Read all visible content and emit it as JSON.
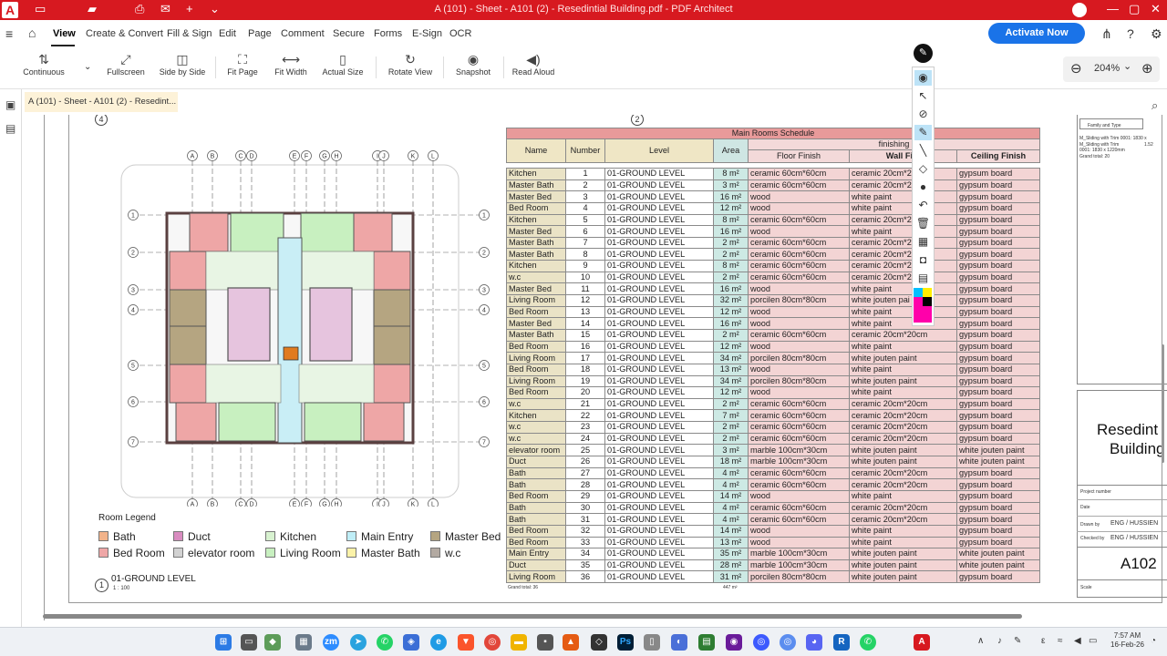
{
  "app": {
    "window_title": "A (101) - Sheet - A101 (2) - Resedintial Building.pdf  -  PDF Architect",
    "logo": "A"
  },
  "menu": {
    "items": [
      "View",
      "Create & Convert",
      "Fill & Sign",
      "Edit",
      "Page",
      "Comment",
      "Secure",
      "Forms",
      "E-Sign",
      "OCR"
    ],
    "active": "View",
    "activate_label": "Activate Now"
  },
  "toolbar": {
    "continuous": "Continuous",
    "fullscreen": "Fullscreen",
    "side_by_side": "Side by Side",
    "fit_page": "Fit Page",
    "fit_width": "Fit Width",
    "actual_size": "Actual Size",
    "rotate_view": "Rotate View",
    "snapshot": "Snapshot",
    "read_aloud": "Read Aloud",
    "zoom": "204%"
  },
  "tab": {
    "label": "A (101) - Sheet - A101 (2) - Resedint..."
  },
  "drawing": {
    "view_number_left": "4",
    "view_number_right": "2",
    "grid_columns": [
      "A",
      "B",
      "C",
      "D",
      "E",
      "F",
      "G",
      "H",
      "I",
      "J",
      "K",
      "L"
    ],
    "grid_rows": [
      "1",
      "2",
      "3",
      "4",
      "5",
      "6",
      "7"
    ],
    "legend_title": "Room Legend",
    "legend": [
      {
        "label": "Bath",
        "color": "#f2b38a"
      },
      {
        "label": "Duct",
        "color": "#d98cc0"
      },
      {
        "label": "Kitchen",
        "color": "#d8f2d0"
      },
      {
        "label": "Main Entry",
        "color": "#bfeef7"
      },
      {
        "label": "Master Bed",
        "color": "#b5a581"
      },
      {
        "label": "Bed Room",
        "color": "#eea6a6"
      },
      {
        "label": "elevator room",
        "color": "#d2d2d2"
      },
      {
        "label": "Living Room",
        "color": "#c8f0c0"
      },
      {
        "label": "Master Bath",
        "color": "#fbf2a8"
      },
      {
        "label": "w.c",
        "color": "#b3aaa2"
      }
    ],
    "level_number": "1",
    "level_name": "01-GROUND LEVEL",
    "level_scale": "1 : 100"
  },
  "schedule": {
    "title": "Main Rooms Schedule",
    "headers": {
      "name": "Name",
      "number": "Number",
      "level": "Level",
      "area": "Area",
      "finishing": "finishing",
      "floor": "Floor Finish",
      "wall": "Wall Fini",
      "ceiling": "Ceiling Finish"
    },
    "rows": [
      [
        "Kitchen",
        "1",
        "01-GROUND LEVEL",
        "8 m²",
        "ceramic 60cm*60cm",
        "ceramic 20cm*2",
        "gypsum board"
      ],
      [
        "Master Bath",
        "2",
        "01-GROUND LEVEL",
        "3 m²",
        "ceramic 60cm*60cm",
        "ceramic 20cm*2",
        "gypsum board"
      ],
      [
        "Master Bed",
        "3",
        "01-GROUND LEVEL",
        "16 m²",
        "wood",
        "white paint",
        "gypsum board"
      ],
      [
        "Bed Room",
        "4",
        "01-GROUND LEVEL",
        "12 m²",
        "wood",
        "white paint",
        "gypsum board"
      ],
      [
        "Kitchen",
        "5",
        "01-GROUND LEVEL",
        "8 m²",
        "ceramic 60cm*60cm",
        "ceramic 20cm*2",
        "gypsum board"
      ],
      [
        "Master Bed",
        "6",
        "01-GROUND LEVEL",
        "16 m²",
        "wood",
        "white paint",
        "gypsum board"
      ],
      [
        "Master Bath",
        "7",
        "01-GROUND LEVEL",
        "2 m²",
        "ceramic 60cm*60cm",
        "ceramic 20cm*2",
        "gypsum board"
      ],
      [
        "Master Bath",
        "8",
        "01-GROUND LEVEL",
        "2 m²",
        "ceramic 60cm*60cm",
        "ceramic 20cm*2",
        "gypsum board"
      ],
      [
        "Kitchen",
        "9",
        "01-GROUND LEVEL",
        "8 m²",
        "ceramic 60cm*60cm",
        "ceramic 20cm*2",
        "gypsum board"
      ],
      [
        "w.c",
        "10",
        "01-GROUND LEVEL",
        "2 m²",
        "ceramic 60cm*60cm",
        "ceramic 20cm*2",
        "gypsum board"
      ],
      [
        "Master Bed",
        "11",
        "01-GROUND LEVEL",
        "16 m²",
        "wood",
        "white paint",
        "gypsum board"
      ],
      [
        "Living Room",
        "12",
        "01-GROUND LEVEL",
        "32 m²",
        "porcilen 80cm*80cm",
        "white jouten pai",
        "gypsum board"
      ],
      [
        "Bed Room",
        "13",
        "01-GROUND LEVEL",
        "12 m²",
        "wood",
        "white paint",
        "gypsum board"
      ],
      [
        "Master Bed",
        "14",
        "01-GROUND LEVEL",
        "16 m²",
        "wood",
        "white paint",
        "gypsum board"
      ],
      [
        "Master Bath",
        "15",
        "01-GROUND LEVEL",
        "2 m²",
        "ceramic 60cm*60cm",
        "ceramic 20cm*20cm",
        "gypsum board"
      ],
      [
        "Bed Room",
        "16",
        "01-GROUND LEVEL",
        "12 m²",
        "wood",
        "white paint",
        "gypsum board"
      ],
      [
        "Living Room",
        "17",
        "01-GROUND LEVEL",
        "34 m²",
        "porcilen 80cm*80cm",
        "white jouten paint",
        "gypsum board"
      ],
      [
        "Bed Room",
        "18",
        "01-GROUND LEVEL",
        "13 m²",
        "wood",
        "white paint",
        "gypsum board"
      ],
      [
        "Living Room",
        "19",
        "01-GROUND LEVEL",
        "34 m²",
        "porcilen 80cm*80cm",
        "white jouten paint",
        "gypsum board"
      ],
      [
        "Bed Room",
        "20",
        "01-GROUND LEVEL",
        "12 m²",
        "wood",
        "white paint",
        "gypsum board"
      ],
      [
        "w.c",
        "21",
        "01-GROUND LEVEL",
        "2 m²",
        "ceramic 60cm*60cm",
        "ceramic 20cm*20cm",
        "gypsum board"
      ],
      [
        "Kitchen",
        "22",
        "01-GROUND LEVEL",
        "7 m²",
        "ceramic 60cm*60cm",
        "ceramic 20cm*20cm",
        "gypsum board"
      ],
      [
        "w.c",
        "23",
        "01-GROUND LEVEL",
        "2 m²",
        "ceramic 60cm*60cm",
        "ceramic 20cm*20cm",
        "gypsum board"
      ],
      [
        "w.c",
        "24",
        "01-GROUND LEVEL",
        "2 m²",
        "ceramic 60cm*60cm",
        "ceramic 20cm*20cm",
        "gypsum board"
      ],
      [
        "elevator room",
        "25",
        "01-GROUND LEVEL",
        "3 m²",
        "marble 100cm*30cm",
        "white jouten paint",
        "white jouten paint"
      ],
      [
        "Duct",
        "26",
        "01-GROUND LEVEL",
        "18 m²",
        "marble 100cm*30cm",
        "white jouten paint",
        "white jouten paint"
      ],
      [
        "Bath",
        "27",
        "01-GROUND LEVEL",
        "4 m²",
        "ceramic 60cm*60cm",
        "ceramic 20cm*20cm",
        "gypsum board"
      ],
      [
        "Bath",
        "28",
        "01-GROUND LEVEL",
        "4 m²",
        "ceramic 60cm*60cm",
        "ceramic 20cm*20cm",
        "gypsum board"
      ],
      [
        "Bed Room",
        "29",
        "01-GROUND LEVEL",
        "14 m²",
        "wood",
        "white paint",
        "gypsum board"
      ],
      [
        "Bath",
        "30",
        "01-GROUND LEVEL",
        "4 m²",
        "ceramic 60cm*60cm",
        "ceramic 20cm*20cm",
        "gypsum board"
      ],
      [
        "Bath",
        "31",
        "01-GROUND LEVEL",
        "4 m²",
        "ceramic 60cm*60cm",
        "ceramic 20cm*20cm",
        "gypsum board"
      ],
      [
        "Bed Room",
        "32",
        "01-GROUND LEVEL",
        "14 m²",
        "wood",
        "white paint",
        "gypsum board"
      ],
      [
        "Bed Room",
        "33",
        "01-GROUND LEVEL",
        "13 m²",
        "wood",
        "white paint",
        "gypsum board"
      ],
      [
        "Main Entry",
        "34",
        "01-GROUND LEVEL",
        "35 m²",
        "marble 100cm*30cm",
        "white jouten paint",
        "white jouten paint"
      ],
      [
        "Duct",
        "35",
        "01-GROUND LEVEL",
        "28 m²",
        "marble 100cm*30cm",
        "white jouten paint",
        "white jouten paint"
      ],
      [
        "Living Room",
        "36",
        "01-GROUND LEVEL",
        "31 m²",
        "porcilen 80cm*80cm",
        "white jouten paint",
        "gypsum board"
      ]
    ],
    "grand_total": "Grand total: 36",
    "area_total": "447 m²"
  },
  "titleblock": {
    "family_type": "Family and Type",
    "sliding1": "M_Sliding with Trim 0001: 1830 x",
    "sliding2": "M_Sliding with Trim 0001: 1830 x 1220mm",
    "dim": "1.52",
    "grand_total": "Grand total: 20",
    "project_line1": "Resedint",
    "project_line2": "Building",
    "project_number": "Project number",
    "date": "Date",
    "drawn_by": "Drawn by",
    "drawn_name": "ENG / HUSSIEN",
    "checked_by": "Checked by",
    "checked_name": "ENG / HUSSIEN",
    "sheet_no": "A102",
    "scale": "Scale"
  },
  "taskbar": {
    "time": "7:57 AM",
    "date": "16-Feb-26"
  }
}
